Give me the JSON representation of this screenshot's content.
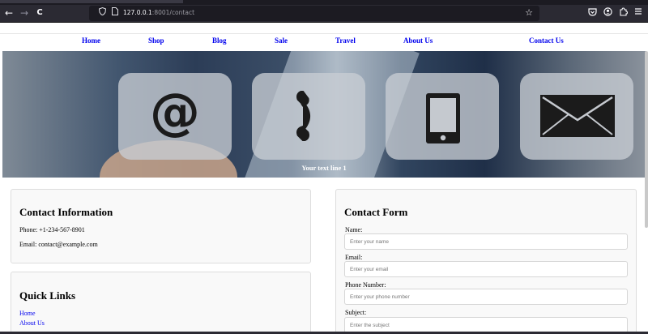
{
  "browser": {
    "back_icon": "←",
    "forward_icon": "→",
    "reload_icon": "C",
    "url_host": "127.0.0.1",
    "url_rest": ":8001/contact",
    "star_icon": "☆"
  },
  "nav": {
    "items": [
      {
        "label": "Home"
      },
      {
        "label": "Shop"
      },
      {
        "label": "Blog"
      },
      {
        "label": "Sale"
      },
      {
        "label": "Travel"
      },
      {
        "label": "About Us"
      },
      {
        "label": "Contact Us"
      }
    ]
  },
  "hero": {
    "caption": "Your text line 1",
    "tiles": [
      "at-sign-icon",
      "phone-icon",
      "mobile-device-icon",
      "envelope-icon"
    ]
  },
  "contact_info": {
    "title": "Contact Information",
    "phone": "Phone: +1-234-567-8901",
    "email": "Email: contact@example.com"
  },
  "quick_links": {
    "title": "Quick Links",
    "links": [
      "Home",
      "About Us"
    ]
  },
  "contact_form": {
    "title": "Contact Form",
    "fields": [
      {
        "label": "Name:",
        "placeholder": "Enter your name",
        "value": ""
      },
      {
        "label": "Email:",
        "placeholder": "Enter your email",
        "value": ""
      },
      {
        "label": "Phone Number:",
        "placeholder": "Enter your phone number",
        "value": ""
      },
      {
        "label": "Subject:",
        "placeholder": "Enter the subject",
        "value": ""
      }
    ]
  },
  "colors": {
    "link": "#0000ee",
    "browser_toolbar": "#2b2a33",
    "card_bg": "#f9f9f9"
  }
}
